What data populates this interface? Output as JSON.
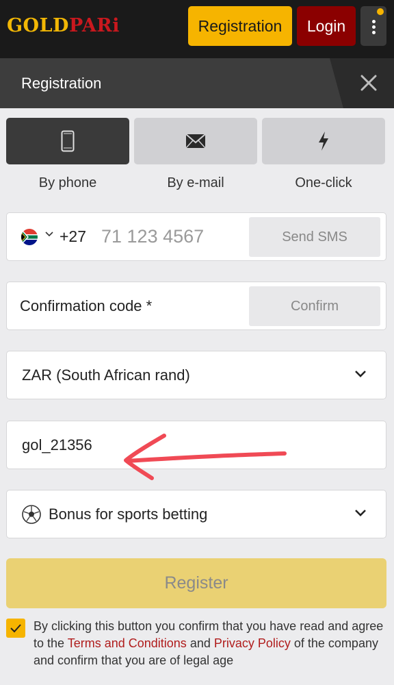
{
  "header": {
    "logo_gold": "GOLD",
    "logo_pari": "PARi",
    "registration_label": "Registration",
    "login_label": "Login"
  },
  "dialog": {
    "title": "Registration"
  },
  "methods": [
    {
      "label": "By phone",
      "icon": "phone-icon",
      "active": true
    },
    {
      "label": "By e-mail",
      "icon": "envelope-icon",
      "active": false
    },
    {
      "label": "One-click",
      "icon": "lightning-icon",
      "active": false
    }
  ],
  "phone": {
    "dial_code": "+27",
    "placeholder": "71 123 4567",
    "send_label": "Send SMS"
  },
  "confirmation": {
    "label": "Confirmation code *",
    "confirm_label": "Confirm"
  },
  "currency": {
    "value": "ZAR (South African rand)"
  },
  "promo": {
    "value": "gol_21356"
  },
  "bonus": {
    "value": "Bonus for sports betting"
  },
  "register_label": "Register",
  "terms": {
    "part1": "By clicking this button you confirm that you have read and agree to the ",
    "link1": "Terms and Conditions",
    "part2": " and ",
    "link2": "Privacy Policy",
    "part3": " of the company and confirm that you are of legal age"
  },
  "colors": {
    "accent_yellow": "#f6b400",
    "login_red": "#8b0000",
    "link_red": "#b01c1c",
    "annotation_arrow": "#f04a55"
  }
}
